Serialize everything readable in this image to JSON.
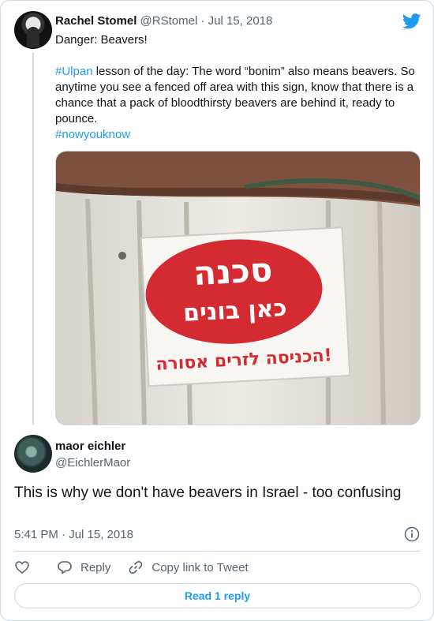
{
  "tweet": {
    "author_name": "Rachel Stomel",
    "author_handle": "@RStomel",
    "separator": "·",
    "date": "Jul 15, 2018",
    "line1": "Danger: Beavers!",
    "hashtag_ulpan": "#Ulpan",
    "line2_rest": " lesson of the day: The word “bonim” also means beavers. So anytime you see a fenced off area with this sign, know that there is a chance that a pack of bloodthirsty beavers are behind it, ready to pounce.",
    "hashtag_now": "#nowyouknow",
    "sign": {
      "line1": "סכנה",
      "line2": "כאן בונים",
      "line3": "הכניסה לזרים אסורה!"
    }
  },
  "reply": {
    "author_name": "maor eichler",
    "author_handle": "@EichlerMaor",
    "text": "This is why we don't have beavers in Israel - too confusing",
    "timestamp": "5:41 PM · Jul 15, 2018"
  },
  "actions": {
    "reply_label": "Reply",
    "copy_label": "Copy link to Tweet",
    "read_reply_label": "Read 1 reply"
  },
  "icons": {
    "brand": "twitter-bird-icon",
    "like": "heart-icon",
    "reply": "reply-bubble-icon",
    "copy": "link-icon",
    "info": "info-icon"
  },
  "colors": {
    "accent": "#1d9bf0",
    "sign_red": "#d42a32"
  }
}
